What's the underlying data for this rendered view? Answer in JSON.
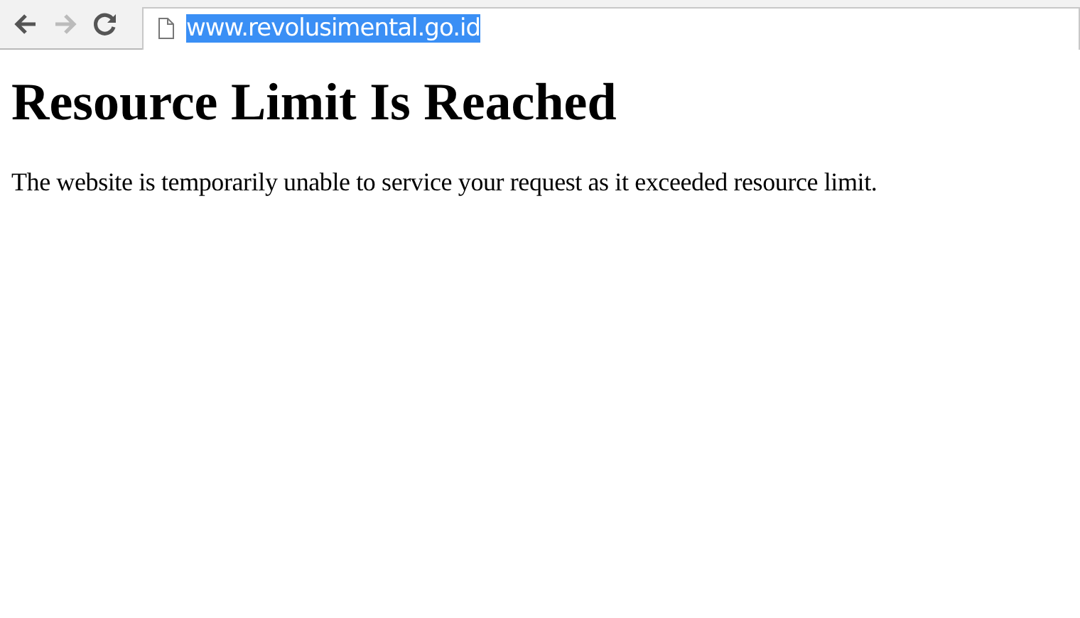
{
  "toolbar": {
    "buttons": [
      {
        "kind": "back",
        "disabled": false
      },
      {
        "kind": "forward",
        "disabled": true
      },
      {
        "kind": "reload",
        "disabled": false
      }
    ],
    "address": {
      "value": "www.revolusimental.go.id",
      "selected": true
    }
  },
  "page": {
    "heading": "Resource Limit Is Reached",
    "message": "The website is temporarily unable to service your request as it exceeded resource limit."
  }
}
